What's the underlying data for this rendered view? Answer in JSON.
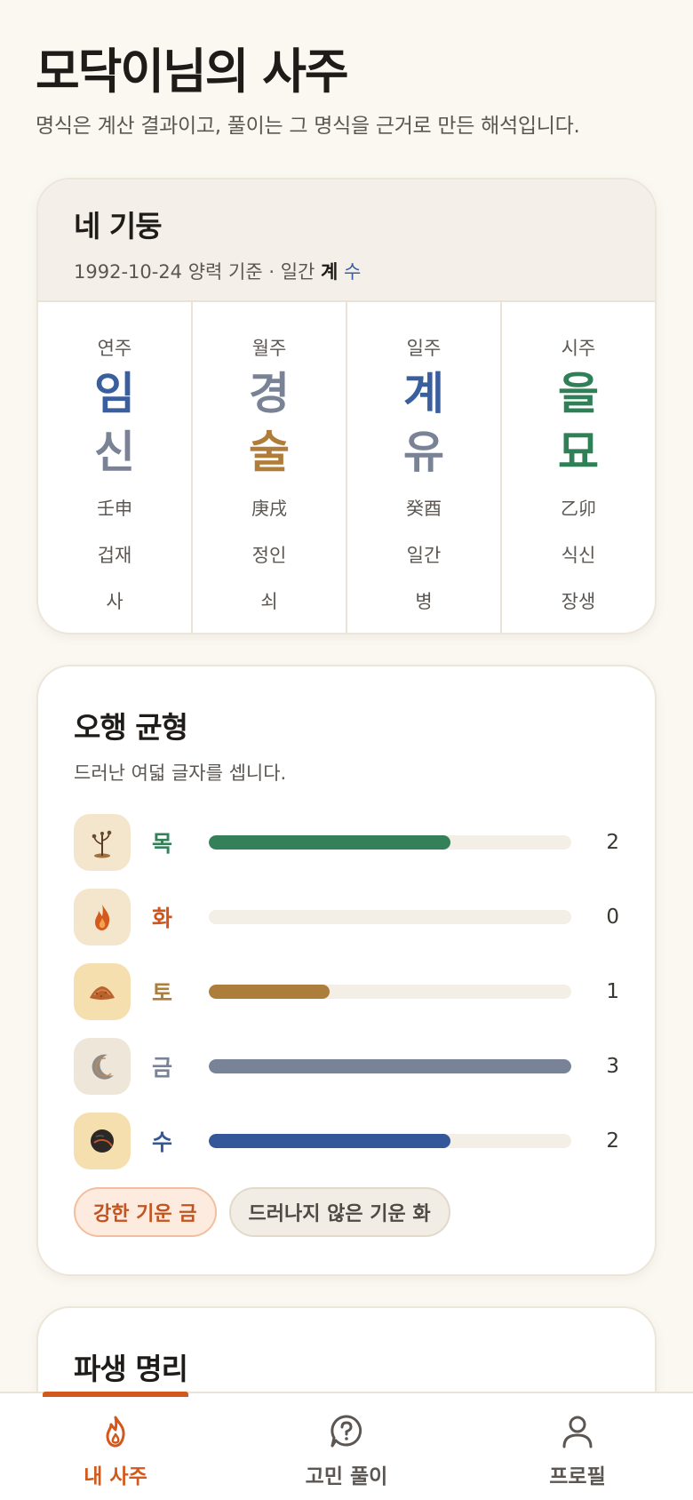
{
  "header": {
    "title": "모닥이님의 사주",
    "subtitle": "명식은 계산 결과이고, 풀이는 그 명식을 근거로 만든 해석입니다."
  },
  "pillars": {
    "title": "네 기둥",
    "subtitle_prefix": "1992-10-24 양력 기준 · 일간 ",
    "day_stem": "계",
    "day_stem_element": "수",
    "columns": [
      {
        "label": "연주",
        "stem": "임",
        "branch": "신",
        "hanja": "壬申",
        "god": "겁재",
        "stage": "사",
        "stem_color": "#3a5f9e",
        "branch_color": "#7a8396"
      },
      {
        "label": "월주",
        "stem": "경",
        "branch": "술",
        "hanja": "庚戌",
        "god": "정인",
        "stage": "쇠",
        "stem_color": "#7a8396",
        "branch_color": "#b07c3a"
      },
      {
        "label": "일주",
        "stem": "계",
        "branch": "유",
        "hanja": "癸酉",
        "god": "일간",
        "stage": "병",
        "stem_color": "#3a5f9e",
        "branch_color": "#7a8396"
      },
      {
        "label": "시주",
        "stem": "을",
        "branch": "묘",
        "hanja": "乙卯",
        "god": "식신",
        "stage": "장생",
        "stem_color": "#2f7f57",
        "branch_color": "#2f7f57"
      }
    ]
  },
  "balance": {
    "title": "오행 균형",
    "subtitle": "드러난 여덟 글자를 셉니다.",
    "max": 3,
    "elements": [
      {
        "name": "목",
        "count": "2",
        "value": 2,
        "color": "#348059",
        "icon": "sapling-icon"
      },
      {
        "name": "화",
        "count": "0",
        "value": 0,
        "color": "#d0541b",
        "icon": "flame-icon"
      },
      {
        "name": "토",
        "count": "1",
        "value": 1,
        "color": "#ad7d3c",
        "icon": "soil-icon"
      },
      {
        "name": "금",
        "count": "3",
        "value": 3,
        "color": "#788397",
        "icon": "crescent-moon-icon"
      },
      {
        "name": "수",
        "count": "2",
        "value": 2,
        "color": "#34579a",
        "icon": "water-orb-icon"
      }
    ],
    "strong_chip": "강한 기운 금",
    "weak_chip": "드러나지 않은 기운 화"
  },
  "pasaeng": {
    "title": "파생 명리"
  },
  "nav": {
    "items": [
      {
        "label": "내 사주",
        "icon": "flame-icon",
        "active": true
      },
      {
        "label": "고민 풀이",
        "icon": "question-bubble-icon",
        "active": false
      },
      {
        "label": "프로필",
        "icon": "person-icon",
        "active": false
      }
    ]
  }
}
